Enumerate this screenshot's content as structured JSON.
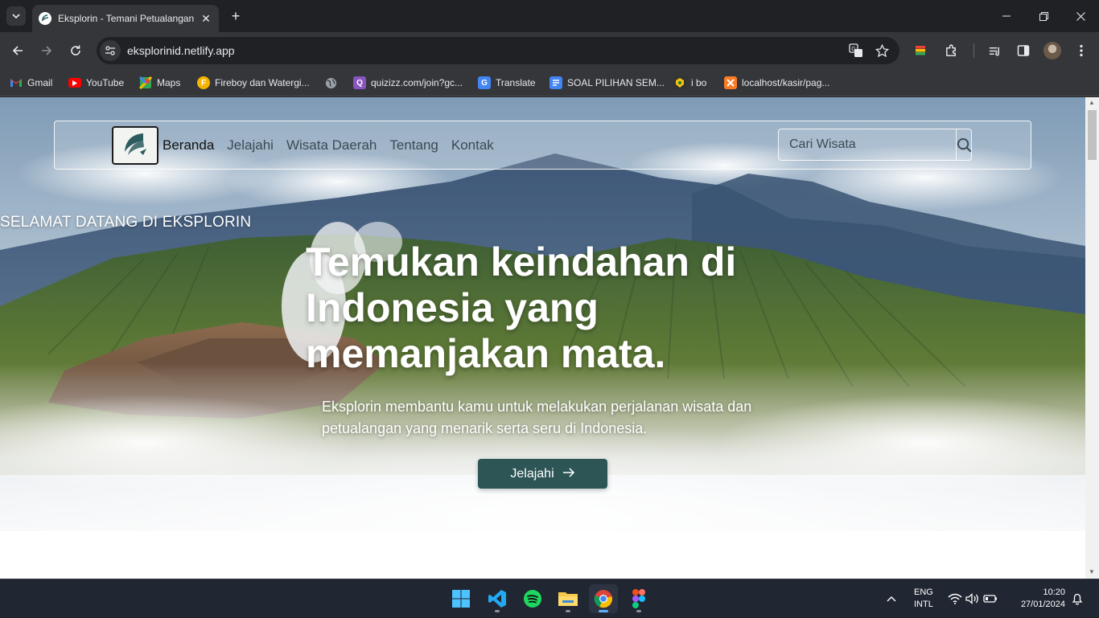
{
  "browser": {
    "tab_title": "Eksplorin - Temani Petualangan",
    "url": "eksplorinid.netlify.app",
    "bookmarks": [
      {
        "label": "Gmail",
        "icon": "gmail-icon",
        "color": "#ea4335"
      },
      {
        "label": "YouTube",
        "icon": "youtube-icon",
        "color": "#ff0000"
      },
      {
        "label": "Maps",
        "icon": "maps-icon",
        "color": "#34a853"
      },
      {
        "label": "Fireboy dan Watergi...",
        "icon": "fireboy-icon",
        "color": "#f4b400"
      },
      {
        "label": "",
        "icon": "globe-icon",
        "color": "#9aa0a6"
      },
      {
        "label": "quizizz.com/join?gc...",
        "icon": "quizizz-icon",
        "color": "#8854c0"
      },
      {
        "label": "Translate",
        "icon": "translate-icon",
        "color": "#4285f4"
      },
      {
        "label": "SOAL PILIHAN SEM...",
        "icon": "docs-icon",
        "color": "#4285f4"
      },
      {
        "label": "i bo",
        "icon": "ibo-icon",
        "color": "#333333"
      },
      {
        "label": "localhost/kasir/pag...",
        "icon": "xampp-icon",
        "color": "#fb7a24"
      }
    ]
  },
  "site": {
    "nav": {
      "items": [
        "Beranda",
        "Jelajahi",
        "Wisata Daerah",
        "Tentang",
        "Kontak"
      ],
      "active": "Beranda"
    },
    "search": {
      "placeholder": "Cari Wisata"
    },
    "hero": {
      "kicker": "SELAMAT DATANG DI EKSPLORIN",
      "title": "Temukan keindahan di Indonesia yang memanjakan mata.",
      "subtitle": "Eksplorin membantu kamu untuk melakukan perjalanan wisata dan petualangan yang menarik serta seru di Indonesia.",
      "cta_label": "Jelajahi"
    },
    "colors": {
      "cta": "#2d5556",
      "logo_mark": "#2e5c5e"
    }
  },
  "taskbar": {
    "apps": [
      "windows-start",
      "vscode",
      "spotify",
      "file-explorer",
      "chrome",
      "figma"
    ],
    "active_app": "chrome",
    "lang_top": "ENG",
    "lang_bottom": "INTL",
    "time": "10:20",
    "date": "27/01/2024"
  }
}
